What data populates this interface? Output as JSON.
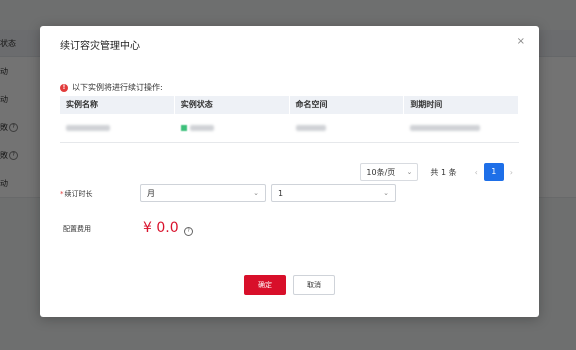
{
  "background": {
    "header_label": "状态",
    "rows": [
      {
        "label": "动",
        "help": false
      },
      {
        "label": "动",
        "help": false
      },
      {
        "label": "敗",
        "help": true
      },
      {
        "label": "敗",
        "help": true
      },
      {
        "label": "动",
        "help": false
      }
    ]
  },
  "modal": {
    "title": "续订容灾管理中心",
    "close_glyph": "×",
    "notice": "以下实例将进行续订操作:",
    "warning_glyph": "!",
    "table": {
      "headers": [
        "实例名称",
        "实例状态",
        "命名空间",
        "到期时间"
      ]
    },
    "pagination": {
      "page_size": "10条/页",
      "total": "共 1 条",
      "prev": "‹",
      "next": "›",
      "current": "1"
    },
    "form": {
      "duration_label": "续订时长",
      "required_mark": "*",
      "unit_value": "月",
      "count_value": "1",
      "fee_label": "配置费用",
      "price": "¥ 0.0",
      "help_glyph": "?"
    },
    "buttons": {
      "confirm": "确定",
      "cancel": "取消"
    }
  },
  "colors": {
    "accent_red": "#d80f2a",
    "pager_blue": "#1e6fe8",
    "status_green": "#3cc07a"
  }
}
